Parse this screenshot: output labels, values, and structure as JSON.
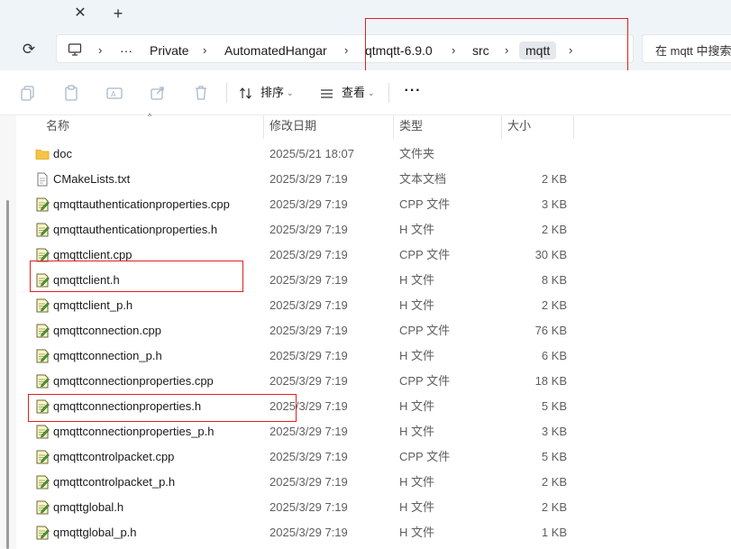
{
  "tabs": {
    "close_glyph": "✕",
    "new_glyph": "+"
  },
  "nav": {
    "refresh_glyph": "⟳",
    "breadcrumb": [
      "···",
      "Private",
      "AutomatedHangar",
      "qtmqtt-6.9.0",
      "src",
      "mqtt"
    ],
    "separator": "›",
    "search_placeholder": "在 mqtt 中搜索"
  },
  "toolbar": {
    "sort_label": "排序",
    "view_label": "查看",
    "more_glyph": "···"
  },
  "columns": {
    "name": "名称",
    "date": "修改日期",
    "type": "类型",
    "size": "大小"
  },
  "files": [
    {
      "name": "doc",
      "date": "2025/5/21 18:07",
      "type": "文件夹",
      "size": "",
      "icon": "folder-icon"
    },
    {
      "name": "CMakeLists.txt",
      "date": "2025/3/29 7:19",
      "type": "文本文档",
      "size": "2 KB",
      "icon": "text-file-icon"
    },
    {
      "name": "qmqttauthenticationproperties.cpp",
      "date": "2025/3/29 7:19",
      "type": "CPP 文件",
      "size": "3 KB",
      "icon": "source-file-icon"
    },
    {
      "name": "qmqttauthenticationproperties.h",
      "date": "2025/3/29 7:19",
      "type": "H 文件",
      "size": "2 KB",
      "icon": "source-file-icon"
    },
    {
      "name": "qmqttclient.cpp",
      "date": "2025/3/29 7:19",
      "type": "CPP 文件",
      "size": "30 KB",
      "icon": "source-file-icon"
    },
    {
      "name": "qmqttclient.h",
      "date": "2025/3/29 7:19",
      "type": "H 文件",
      "size": "8 KB",
      "icon": "source-file-icon"
    },
    {
      "name": "qmqttclient_p.h",
      "date": "2025/3/29 7:19",
      "type": "H 文件",
      "size": "2 KB",
      "icon": "source-file-icon"
    },
    {
      "name": "qmqttconnection.cpp",
      "date": "2025/3/29 7:19",
      "type": "CPP 文件",
      "size": "76 KB",
      "icon": "source-file-icon"
    },
    {
      "name": "qmqttconnection_p.h",
      "date": "2025/3/29 7:19",
      "type": "H 文件",
      "size": "6 KB",
      "icon": "source-file-icon"
    },
    {
      "name": "qmqttconnectionproperties.cpp",
      "date": "2025/3/29 7:19",
      "type": "CPP 文件",
      "size": "18 KB",
      "icon": "source-file-icon"
    },
    {
      "name": "qmqttconnectionproperties.h",
      "date": "2025/3/29 7:19",
      "type": "H 文件",
      "size": "5 KB",
      "icon": "source-file-icon"
    },
    {
      "name": "qmqttconnectionproperties_p.h",
      "date": "2025/3/29 7:19",
      "type": "H 文件",
      "size": "3 KB",
      "icon": "source-file-icon"
    },
    {
      "name": "qmqttcontrolpacket.cpp",
      "date": "2025/3/29 7:19",
      "type": "CPP 文件",
      "size": "5 KB",
      "icon": "source-file-icon"
    },
    {
      "name": "qmqttcontrolpacket_p.h",
      "date": "2025/3/29 7:19",
      "type": "H 文件",
      "size": "2 KB",
      "icon": "source-file-icon"
    },
    {
      "name": "qmqttglobal.h",
      "date": "2025/3/29 7:19",
      "type": "H 文件",
      "size": "2 KB",
      "icon": "source-file-icon"
    },
    {
      "name": "qmqttglobal_p.h",
      "date": "2025/3/29 7:19",
      "type": "H 文件",
      "size": "1 KB",
      "icon": "source-file-icon"
    }
  ],
  "colors": {
    "annotation": "#e02020",
    "folder": "#f5c542",
    "accent": "#0067c0"
  }
}
